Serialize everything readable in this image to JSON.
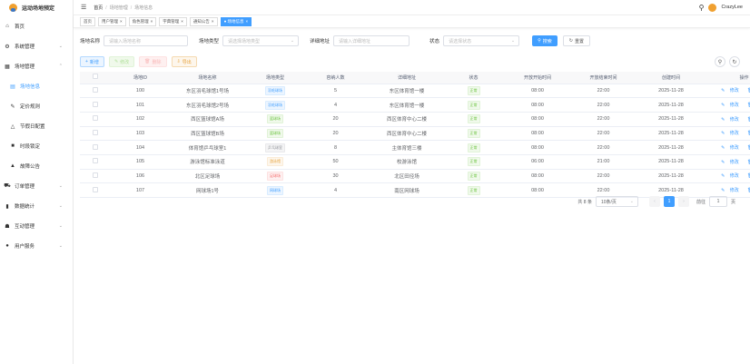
{
  "app": {
    "title": "运动场地预定",
    "user": "CrazyLee"
  },
  "sidebar": {
    "items": [
      {
        "label": "首页",
        "icon": "home-icon"
      },
      {
        "label": "系统管理",
        "icon": "gear-icon"
      },
      {
        "label": "场地管理",
        "icon": "grid-icon"
      },
      {
        "label": "场地信息",
        "icon": "list-icon"
      },
      {
        "label": "定价规则",
        "icon": "edit-icon"
      },
      {
        "label": "节假日配置",
        "icon": "bell-icon"
      },
      {
        "label": "时段锁定",
        "icon": "lock-icon"
      },
      {
        "label": "故障公告",
        "icon": "alert-icon"
      },
      {
        "label": "订单管理",
        "icon": "cart-icon"
      },
      {
        "label": "数据统计",
        "icon": "chart-icon"
      },
      {
        "label": "互动管理",
        "icon": "chat-icon"
      },
      {
        "label": "用户服务",
        "icon": "user-icon"
      }
    ]
  },
  "breadcrumb": {
    "home": "首页",
    "parent": "场地管理",
    "current": "场地信息"
  },
  "tags": [
    "首页",
    "用户管理",
    "角色管理",
    "字典管理",
    "通知公告",
    "场地信息"
  ],
  "filters": {
    "name_label": "场地名称",
    "name_placeholder": "请输入场地名称",
    "type_label": "场地类型",
    "type_placeholder": "请选择场地类型",
    "addr_label": "详细地址",
    "addr_placeholder": "请输入详细地址",
    "status_label": "状态",
    "status_placeholder": "请选择状态",
    "search": "搜索",
    "reset": "重置"
  },
  "actions": {
    "add": "新增",
    "edit": "修改",
    "delete": "删除",
    "export": "导出"
  },
  "table": {
    "headers": [
      "场地ID",
      "场地名称",
      "场地类型",
      "容纳人数",
      "详细地址",
      "状态",
      "开放开始时间",
      "开放结束时间",
      "创建时间",
      "操作"
    ],
    "rows": [
      {
        "id": "100",
        "name": "东区羽毛球馆1号场",
        "type": "羽毛球场",
        "tcolor": "blue",
        "cap": "5",
        "addr": "东区体育馆一楼",
        "status": "正常",
        "start": "08:00",
        "end": "22:00",
        "created": "2025-11-28"
      },
      {
        "id": "101",
        "name": "东区羽毛球馆2号场",
        "type": "羽毛球场",
        "tcolor": "blue",
        "cap": "4",
        "addr": "东区体育馆一楼",
        "status": "正常",
        "start": "08:00",
        "end": "22:00",
        "created": "2025-11-28"
      },
      {
        "id": "102",
        "name": "西区篮球馆A场",
        "type": "篮球场",
        "tcolor": "green",
        "cap": "20",
        "addr": "西区体育中心二楼",
        "status": "正常",
        "start": "08:00",
        "end": "22:00",
        "created": "2025-11-28"
      },
      {
        "id": "103",
        "name": "西区篮球馆B场",
        "type": "篮球场",
        "tcolor": "green",
        "cap": "20",
        "addr": "西区体育中心二楼",
        "status": "正常",
        "start": "08:00",
        "end": "22:00",
        "created": "2025-11-28"
      },
      {
        "id": "104",
        "name": "体育馆乒乓球室1",
        "type": "乒乓球室",
        "tcolor": "gray",
        "cap": "8",
        "addr": "主体育馆三楼",
        "status": "正常",
        "start": "08:00",
        "end": "22:00",
        "created": "2025-11-28"
      },
      {
        "id": "105",
        "name": "游泳馆标准泳道",
        "type": "游泳馆",
        "tcolor": "orange",
        "cap": "50",
        "addr": "校游泳馆",
        "status": "正常",
        "start": "06:00",
        "end": "21:00",
        "created": "2025-11-28"
      },
      {
        "id": "106",
        "name": "北区足球场",
        "type": "足球场",
        "tcolor": "red",
        "cap": "30",
        "addr": "北区田径场",
        "status": "正常",
        "start": "08:00",
        "end": "22:00",
        "created": "2025-11-28"
      },
      {
        "id": "107",
        "name": "网球场1号",
        "type": "网球场",
        "tcolor": "blue",
        "cap": "4",
        "addr": "南区网球场",
        "status": "正常",
        "start": "08:00",
        "end": "22:00",
        "created": "2025-11-28"
      }
    ],
    "op_edit": "修改",
    "op_delete": "删除"
  },
  "pagination": {
    "total": "共 8 条",
    "page_size": "10条/页",
    "current": "1",
    "goto_label": "前往",
    "goto_value": "1",
    "page_unit": "页"
  }
}
